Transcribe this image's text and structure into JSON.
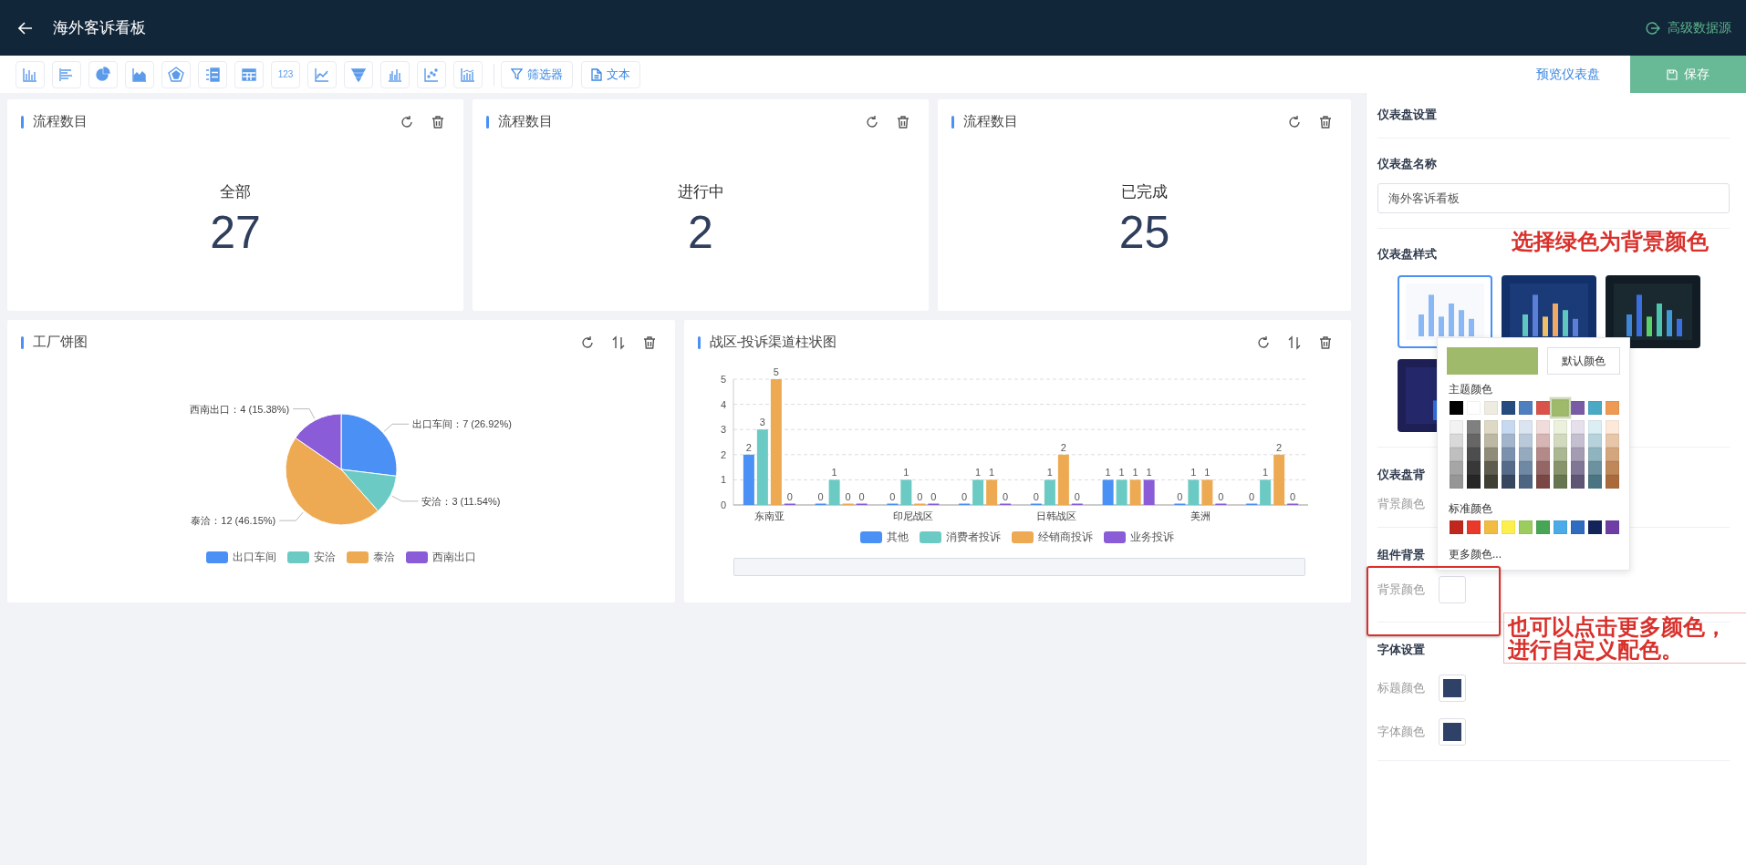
{
  "header": {
    "title": "海外客诉看板",
    "action": "高级数据源"
  },
  "toolbar": {
    "tools": [
      {
        "kind": "bar"
      },
      {
        "kind": "hbar"
      },
      {
        "kind": "pie"
      },
      {
        "kind": "area"
      },
      {
        "kind": "radar"
      },
      {
        "kind": "list"
      },
      {
        "kind": "table"
      },
      {
        "kind": "number",
        "label": "123"
      },
      {
        "kind": "line"
      },
      {
        "kind": "funnel"
      },
      {
        "kind": "group"
      },
      {
        "kind": "scatter"
      },
      {
        "kind": "combo"
      }
    ],
    "buttons": [
      {
        "kind": "filter",
        "label": "筛选器"
      },
      {
        "kind": "text",
        "label": "文本"
      }
    ],
    "preview": "预览仪表盘",
    "save": "保存"
  },
  "stat_cards": [
    {
      "title": "流程数目",
      "label": "全部",
      "value": "27"
    },
    {
      "title": "流程数目",
      "label": "进行中",
      "value": "2"
    },
    {
      "title": "流程数目",
      "label": "已完成",
      "value": "25"
    }
  ],
  "pie_card": {
    "title": "工厂饼图",
    "chart_data": {
      "type": "pie",
      "categories": [
        "出口车间",
        "安洽",
        "泰洽",
        "西南出口"
      ],
      "values": [
        7,
        3,
        12,
        4
      ],
      "value_labels": [
        "出口车间：7 (26.92%)",
        "安洽：3 (11.54%)",
        "泰洽：12 (46.15%)",
        "西南出口：4 (15.38%)"
      ],
      "legend": true
    }
  },
  "bar_card": {
    "title": "战区-投诉渠道柱状图",
    "chart_data": {
      "type": "bar",
      "categories": [
        "东南亚",
        null,
        "印尼战区",
        null,
        "日韩战区",
        null,
        "美洲",
        null
      ],
      "ylim": [
        0,
        5
      ],
      "yticks": [
        0,
        1,
        2,
        3,
        4,
        5
      ],
      "data_labels": true,
      "grid": true,
      "legend": true,
      "series": [
        {
          "name": "其他",
          "color": "#4a90f5",
          "values": [
            2,
            0,
            0,
            0,
            0,
            1,
            0,
            0
          ]
        },
        {
          "name": "消费者投诉",
          "color": "#6ccac4",
          "values": [
            3,
            1,
            1,
            1,
            1,
            1,
            1,
            1
          ]
        },
        {
          "name": "经销商投诉",
          "color": "#edaa52",
          "values": [
            5,
            0,
            0,
            1,
            2,
            1,
            1,
            2
          ]
        },
        {
          "name": "业务投诉",
          "color": "#8a5cd8",
          "values": [
            0,
            0,
            0,
            0,
            0,
            1,
            0,
            0
          ]
        }
      ]
    }
  },
  "settings": {
    "title": "仪表盘设置",
    "name_label": "仪表盘名称",
    "name_value": "海外客诉看板",
    "style_label": "仪表盘样式",
    "styles": [
      {
        "kind": "light",
        "selected": true
      },
      {
        "kind": "ocean",
        "selected": false
      },
      {
        "kind": "space",
        "selected": false
      },
      {
        "kind": "neon",
        "selected": false
      }
    ],
    "dashboard_bg_label": "仪表盘背",
    "dashboard_bg_field": "背景颜色",
    "widget_bg_label": "组件背景",
    "widget_bg_field": {
      "label": "背景颜色",
      "color": "#ffffff"
    },
    "font_label": "字体设置",
    "font_fields": [
      {
        "label": "标题颜色",
        "color": "#2f4166"
      },
      {
        "label": "字体颜色",
        "color": "#2f4166"
      }
    ]
  },
  "color_picker": {
    "preview": {
      "color": "#9fba6a"
    },
    "default_button": "默认颜色",
    "theme_label": "主题颜色",
    "theme_colors": [
      {
        "color": "#000000",
        "selected": false
      },
      {
        "color": "#ffffff",
        "selected": false
      },
      {
        "color": "#eeece1",
        "selected": false
      },
      {
        "color": "#264b7e",
        "selected": false
      },
      {
        "color": "#4f7fbf",
        "selected": false
      },
      {
        "color": "#d9534b",
        "selected": false
      },
      {
        "color": "#9fba6a",
        "selected": true
      },
      {
        "color": "#7a5ca6",
        "selected": false
      },
      {
        "color": "#4aaac6",
        "selected": false
      },
      {
        "color": "#ef9a53",
        "selected": false
      }
    ],
    "shades": [
      {
        "color": "#f2f2f2"
      },
      {
        "color": "#808080"
      },
      {
        "color": "#ddd9c4"
      },
      {
        "color": "#c6d9f0"
      },
      {
        "color": "#dbe5f1"
      },
      {
        "color": "#f2dcdb"
      },
      {
        "color": "#ebf1dd"
      },
      {
        "color": "#e5e0ec"
      },
      {
        "color": "#dbeef3"
      },
      {
        "color": "#fde9d9"
      },
      {
        "color": "#d9d9d9"
      },
      {
        "color": "#666666"
      },
      {
        "color": "#bcb8a3"
      },
      {
        "color": "#a3b5cd"
      },
      {
        "color": "#bac9da"
      },
      {
        "color": "#d6b5b4"
      },
      {
        "color": "#d1dabf"
      },
      {
        "color": "#c5c0d1"
      },
      {
        "color": "#b7d2db"
      },
      {
        "color": "#e8c7a9"
      },
      {
        "color": "#bfbfbf"
      },
      {
        "color": "#4d4d4d"
      },
      {
        "color": "#8f8c79"
      },
      {
        "color": "#7c91ae"
      },
      {
        "color": "#95a9bf"
      },
      {
        "color": "#b48a89"
      },
      {
        "color": "#abb693"
      },
      {
        "color": "#a49cb3"
      },
      {
        "color": "#90b3c0"
      },
      {
        "color": "#d5a67e"
      },
      {
        "color": "#a6a6a6"
      },
      {
        "color": "#383838"
      },
      {
        "color": "#5f5d4f"
      },
      {
        "color": "#566b89"
      },
      {
        "color": "#6f88a4"
      },
      {
        "color": "#946665"
      },
      {
        "color": "#88946c"
      },
      {
        "color": "#7f7795"
      },
      {
        "color": "#6c919f"
      },
      {
        "color": "#bf875a"
      },
      {
        "color": "#969696"
      },
      {
        "color": "#262626"
      },
      {
        "color": "#403f33"
      },
      {
        "color": "#36475f"
      },
      {
        "color": "#4e6683"
      },
      {
        "color": "#7a4745"
      },
      {
        "color": "#677550"
      },
      {
        "color": "#5f5676"
      },
      {
        "color": "#4b7582"
      },
      {
        "color": "#a96b3c"
      }
    ],
    "standard_label": "标准颜色",
    "standard_colors": [
      {
        "color": "#c0281d"
      },
      {
        "color": "#e8392a"
      },
      {
        "color": "#f2bb41"
      },
      {
        "color": "#fdf04e"
      },
      {
        "color": "#9ccc5e"
      },
      {
        "color": "#48a556"
      },
      {
        "color": "#4aabe8"
      },
      {
        "color": "#2d6cbf"
      },
      {
        "color": "#13245a"
      },
      {
        "color": "#6f3ea5"
      }
    ],
    "more": "更多颜色..."
  },
  "annotation_top": "选择绿色为背景颜色",
  "annotation_bottom": "也可以点击更多颜色，进行自定义配色。"
}
